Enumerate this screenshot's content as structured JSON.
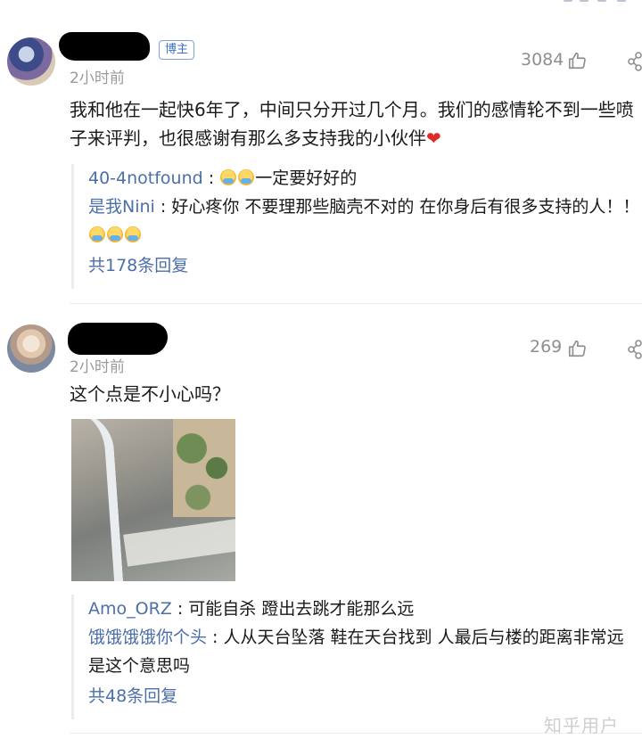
{
  "comments": [
    {
      "author_badge": "博主",
      "time": "2小时前",
      "likes": "3084",
      "text": "我和他在一起快6年了，中间只分开过几个月。我们的感情轮不到一些喷子来评判，也很感谢有那么多支持我的小伙伴",
      "replies": [
        {
          "user": "40-4notfound",
          "sep": " : ",
          "text": "一定要好好的",
          "emoji_count": 2
        },
        {
          "user": "是我Nini",
          "sep": " : ",
          "text": "好心疼你 不要理那些脑壳不对的 在你身后有很多支持的人！！",
          "emoji_count": 3
        }
      ],
      "more_replies": "共178条回复"
    },
    {
      "time": "2小时前",
      "likes": "269",
      "text": "这个点是不小心吗？",
      "replies": [
        {
          "user": "Amo_ORZ",
          "sep": " : ",
          "text": "可能自杀 蹬出去跳才能那么远"
        },
        {
          "user": "饿饿饿饿你个头",
          "sep": " : ",
          "text": "人从天台坠落 鞋在天台找到 人最后与楼的距离非常远 是这个意思吗"
        }
      ],
      "more_replies": "共48条回复"
    }
  ],
  "watermark": "知乎用户",
  "colors": {
    "link": "#4b6fa8",
    "badge": "#3a6fc2",
    "heart": "#e02a2a",
    "meta": "#9a9a9a"
  }
}
